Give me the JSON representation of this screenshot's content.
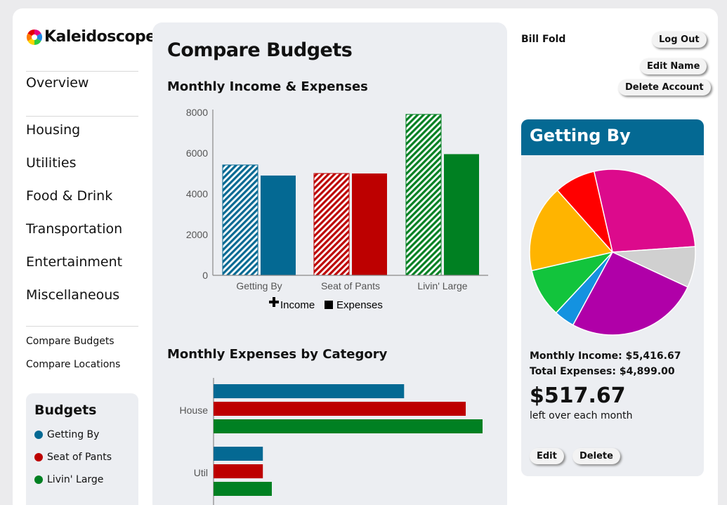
{
  "app": {
    "name": "Kaleidoscope"
  },
  "nav": {
    "overview": "Overview",
    "categories": [
      "Housing",
      "Utilities",
      "Food & Drink",
      "Transportation",
      "Entertainment",
      "Miscellaneous"
    ],
    "compare_budgets": "Compare Budgets",
    "compare_locations": "Compare Locations"
  },
  "budgets_panel": {
    "title": "Budgets",
    "items": [
      {
        "label": "Getting By",
        "color": "#046993"
      },
      {
        "label": "Seat of Pants",
        "color": "#bd0000"
      },
      {
        "label": "Livin' Large",
        "color": "#008022"
      }
    ]
  },
  "main": {
    "title": "Compare Budgets",
    "chart1_title": "Monthly Income & Expenses",
    "chart2_title": "Monthly Expenses by Category"
  },
  "user": {
    "name": "Bill Fold",
    "logout_label": "Log Out",
    "edit_name_label": "Edit Name",
    "delete_account_label": "Delete Account"
  },
  "summary": {
    "title": "Getting By",
    "monthly_income": "Monthly Income: $5,416.67",
    "total_expenses": "Total Expenses: $4,899.00",
    "leftover": "$517.67",
    "leftover_label": "left over each month",
    "edit_label": "Edit",
    "delete_label": "Delete"
  },
  "chart_data": [
    {
      "type": "bar",
      "title": "Monthly Income & Expenses",
      "categories": [
        "Getting By",
        "Seat of Pants",
        "Livin' Large"
      ],
      "series": [
        {
          "name": "Income",
          "values": [
            5417,
            5000,
            7900
          ]
        },
        {
          "name": "Expenses",
          "values": [
            4899,
            5000,
            5950
          ]
        }
      ],
      "colors": [
        "#046993",
        "#bd0000",
        "#008022"
      ],
      "ylim": [
        0,
        8000
      ],
      "yticks": [
        0,
        2000,
        4000,
        6000,
        8000
      ],
      "legend": "bottom"
    },
    {
      "type": "bar",
      "orientation": "horizontal",
      "title": "Monthly Expenses by Category",
      "categories": [
        "House",
        "Util"
      ],
      "series": [
        {
          "name": "Getting By",
          "values": [
            1700,
            440
          ]
        },
        {
          "name": "Seat of Pants",
          "values": [
            2250,
            440
          ]
        },
        {
          "name": "Livin' Large",
          "values": [
            2400,
            520
          ]
        }
      ],
      "colors": [
        "#046993",
        "#bd0000",
        "#008022"
      ],
      "xlim": [
        0,
        2400
      ]
    },
    {
      "type": "pie",
      "slices": [
        {
          "value": 27.5,
          "color": "#dc0a8c"
        },
        {
          "value": 8,
          "color": "#d0d0d0"
        },
        {
          "value": 26,
          "color": "#b000a8"
        },
        {
          "value": 4,
          "color": "#1492e0"
        },
        {
          "value": 9.5,
          "color": "#12c43c"
        },
        {
          "value": 17,
          "color": "#ffb400"
        },
        {
          "value": 8,
          "color": "#ff0000"
        }
      ]
    }
  ]
}
